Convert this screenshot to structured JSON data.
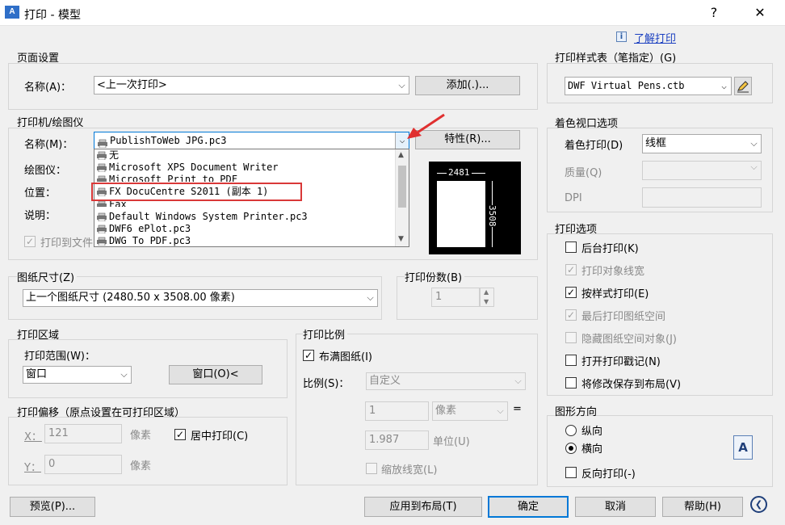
{
  "window": {
    "title": "打印 - 模型",
    "app_icon_text": "A",
    "help_glyph": "?",
    "close_glyph": "✕"
  },
  "learn_link": {
    "icon_text": "i",
    "label": "了解打印"
  },
  "page_setup": {
    "title": "页面设置",
    "name_label": "名称(A)：",
    "name_value": "<上一次打印>",
    "add_button": "添加(.)..."
  },
  "printer": {
    "title": "打印机/绘图仪",
    "name_label": "名称(M)：",
    "name_value": "PublishToWeb JPG.pc3",
    "properties_button": "特性(R)...",
    "plotter_label": "绘图仪：",
    "location_label": "位置：",
    "description_label": "说明：",
    "print_to_file_label": "打印到文件",
    "print_to_file_checked": true,
    "dropdown_items": [
      "无",
      "Microsoft XPS Document Writer",
      "Microsoft Print to PDF",
      "FX DocuCentre S2011 (副本 1)",
      "Fax",
      "Default Windows System Printer.pc3",
      "DWF6 ePlot.pc3",
      "DWG To PDF.pc3"
    ],
    "highlighted_item_index": 3,
    "preview_width": "2481",
    "preview_height": "3508"
  },
  "paper_size": {
    "title": "图纸尺寸(Z)",
    "value": "上一个图纸尺寸  (2480.50 x 3508.00 像素)"
  },
  "copies": {
    "title": "打印份数(B)",
    "value": "1"
  },
  "plot_area": {
    "title": "打印区域",
    "range_label": "打印范围(W)：",
    "range_value": "窗口",
    "window_button": "窗口(O)<"
  },
  "plot_offset": {
    "title": "打印偏移（原点设置在可打印区域）",
    "x_label": "X：",
    "x_value": "121",
    "x_unit": "像素",
    "y_label": "Y：",
    "y_value": "0",
    "y_unit": "像素",
    "center_label": "居中打印(C)",
    "center_checked": true
  },
  "plot_scale": {
    "title": "打印比例",
    "fit_label": "布满图纸(I)",
    "fit_checked": true,
    "scale_label": "比例(S)：",
    "scale_value": "自定义",
    "value1": "1",
    "unit1": "像素",
    "equals": "=",
    "value2": "1.987",
    "unit2": "单位(U)",
    "lineweight_label": "缩放线宽(L)",
    "lineweight_checked": false
  },
  "style_table": {
    "title": "打印样式表（笔指定）(G)",
    "value": "DWF Virtual Pens.ctb"
  },
  "shaded_viewport": {
    "title": "着色视口选项",
    "shade_label": "着色打印(D)",
    "shade_value": "线框",
    "quality_label": "质量(Q)",
    "dpi_label": "DPI"
  },
  "plot_options": {
    "title": "打印选项",
    "items": [
      {
        "label": "后台打印(K)",
        "checked": false,
        "enabled": true
      },
      {
        "label": "打印对象线宽",
        "checked": true,
        "enabled": false
      },
      {
        "label": "按样式打印(E)",
        "checked": true,
        "enabled": true
      },
      {
        "label": "最后打印图纸空间",
        "checked": true,
        "enabled": false
      },
      {
        "label": "隐藏图纸空间对象(J)",
        "checked": false,
        "enabled": false
      },
      {
        "label": "打开打印戳记(N)",
        "checked": false,
        "enabled": true
      },
      {
        "label": "将修改保存到布局(V)",
        "checked": false,
        "enabled": true
      }
    ]
  },
  "orientation": {
    "title": "图形方向",
    "portrait_label": "纵向",
    "landscape_label": "横向",
    "selected": "landscape",
    "upside_down_label": "反向打印(-)",
    "upside_down_checked": false,
    "orientation_icon_text": "A"
  },
  "footer": {
    "preview_button": "预览(P)...",
    "apply_button": "应用到布局(T)",
    "ok_button": "确定",
    "cancel_button": "取消",
    "help_button": "帮助(H)",
    "expand_glyph": "❮"
  }
}
